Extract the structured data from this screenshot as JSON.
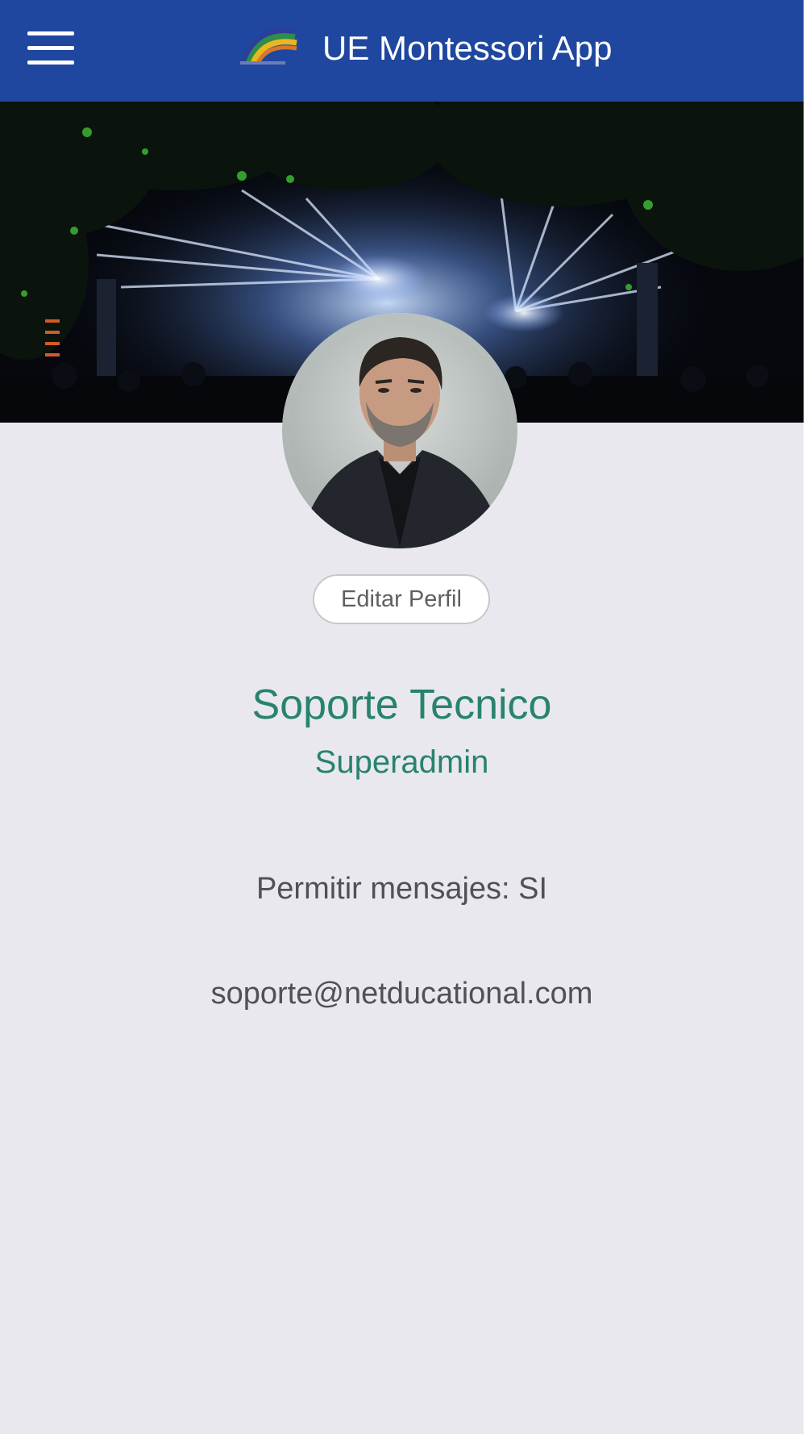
{
  "header": {
    "app_title": "UE Montessori App",
    "menu_icon": "hamburger-menu-icon",
    "logo_icon": "rainbow-logo-icon",
    "background_color": "#1f479f"
  },
  "banner": {
    "image": "concert-stage-lights-photo"
  },
  "profile": {
    "avatar": "profile-photo",
    "edit_button_label": "Editar Perfil",
    "name": "Soporte Tecnico",
    "role": "Superadmin",
    "allow_messages": "Permitir mensajes: SI",
    "email": "soporte@netducational.com",
    "accent_color": "#28836e"
  }
}
